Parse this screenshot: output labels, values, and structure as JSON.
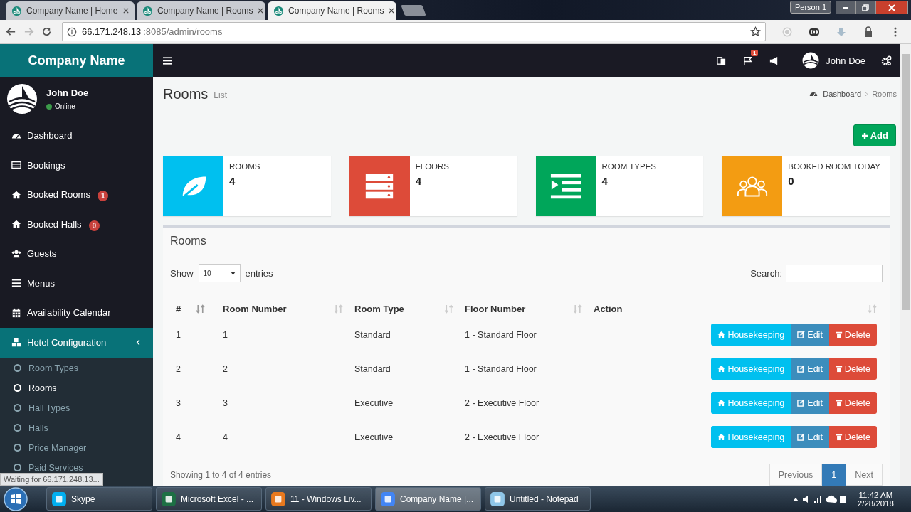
{
  "browser": {
    "tabs": [
      {
        "title": "Company Name | Home",
        "selected": false
      },
      {
        "title": "Company Name | Rooms",
        "selected": false
      },
      {
        "title": "Company Name | Rooms",
        "selected": true
      }
    ],
    "profile": "Person 1",
    "address": {
      "host": "66.171.248.13",
      "path": ":8085/admin/rooms"
    },
    "status": "Waiting for 66.171.248.13..."
  },
  "app": {
    "brand": "Company Name",
    "header": {
      "notification_count": "1",
      "user": "John Doe"
    },
    "sidebar": {
      "user": {
        "name": "John Doe",
        "status": "Online"
      },
      "items": [
        {
          "label": "Dashboard"
        },
        {
          "label": "Bookings"
        },
        {
          "label": "Booked Rooms",
          "badge": "1"
        },
        {
          "label": "Booked Halls",
          "badge": "0"
        },
        {
          "label": "Guests"
        },
        {
          "label": "Menus"
        },
        {
          "label": "Availability Calendar"
        }
      ],
      "group": {
        "label": "Hotel Configuration",
        "expanded": true,
        "children": [
          {
            "label": "Room Types",
            "selected": false
          },
          {
            "label": "Rooms",
            "selected": true
          },
          {
            "label": "Hall Types",
            "selected": false
          },
          {
            "label": "Halls",
            "selected": false
          },
          {
            "label": "Price Manager",
            "selected": false
          },
          {
            "label": "Paid Services",
            "selected": false
          }
        ]
      }
    },
    "page": {
      "title": "Rooms",
      "subtitle": "List",
      "breadcrumb": [
        "Dashboard",
        "Rooms"
      ],
      "add_button": "Add",
      "stats": [
        {
          "label": "ROOMS",
          "value": "4",
          "color": "#00c0ef"
        },
        {
          "label": "FLOORS",
          "value": "4",
          "color": "#dd4b39"
        },
        {
          "label": "ROOM TYPES",
          "value": "4",
          "color": "#00a65a"
        },
        {
          "label": "BOOKED ROOM TODAY",
          "value": "0",
          "color": "#f39c12"
        }
      ],
      "panel": {
        "title": "Rooms",
        "show_label": "Show",
        "page_size": "10",
        "entries_label": "entries",
        "search_label": "Search:",
        "columns": [
          "#",
          "Room Number",
          "Room Type",
          "Floor Number",
          "Action"
        ],
        "rows": [
          {
            "cells": [
              "1",
              "1",
              "Standard",
              "1 - Standard Floor"
            ],
            "actions": [
              {
                "label": "Housekeeping",
                "kind": "info"
              },
              {
                "label": "Edit",
                "kind": "primary"
              },
              {
                "label": "Delete",
                "kind": "danger"
              }
            ]
          },
          {
            "cells": [
              "2",
              "2",
              "Standard",
              "1 - Standard Floor"
            ],
            "actions": [
              {
                "label": "Housekeeping",
                "kind": "info"
              },
              {
                "label": "Edit",
                "kind": "primary"
              },
              {
                "label": "Delete",
                "kind": "danger"
              }
            ]
          },
          {
            "cells": [
              "3",
              "3",
              "Executive",
              "2 - Executive Floor"
            ],
            "actions": [
              {
                "label": "Housekeeping",
                "kind": "info"
              },
              {
                "label": "Edit",
                "kind": "primary"
              },
              {
                "label": "Delete",
                "kind": "danger"
              }
            ]
          },
          {
            "cells": [
              "4",
              "4",
              "Executive",
              "2 - Executive Floor"
            ],
            "actions": [
              {
                "label": "Housekeeping",
                "kind": "info"
              },
              {
                "label": "Edit",
                "kind": "primary"
              },
              {
                "label": "Delete",
                "kind": "danger"
              }
            ]
          }
        ],
        "info": "Showing 1 to 4 of 4 entries",
        "pagination": [
          {
            "label": "Previous",
            "selected": false
          },
          {
            "label": "1",
            "selected": true
          },
          {
            "label": "Next",
            "selected": false
          }
        ]
      }
    }
  },
  "taskbar": {
    "items": [
      {
        "label": "Skype",
        "selected": false
      },
      {
        "label": "Microsoft Excel - ...",
        "selected": false
      },
      {
        "label": "11 - Windows Liv...",
        "selected": false
      },
      {
        "label": "Company Name |...",
        "selected": true
      },
      {
        "label": "Untitled - Notepad",
        "selected": false
      }
    ],
    "time": "11:42 AM",
    "date": "2/28/2018"
  }
}
